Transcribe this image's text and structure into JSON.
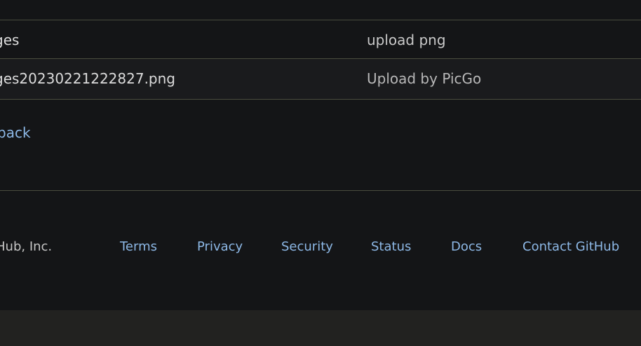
{
  "file_list": {
    "rows": [
      {
        "name": "ges",
        "commit_message": "upload png"
      },
      {
        "name": "ges20230221222827.png",
        "commit_message": "Upload by PicGo"
      }
    ]
  },
  "back_link": "back",
  "footer": {
    "copyright": "Hub, Inc.",
    "links": {
      "terms": "Terms",
      "privacy": "Privacy",
      "security": "Security",
      "status": "Status",
      "docs": "Docs",
      "contact": "Contact GitHub"
    }
  },
  "colors": {
    "background": "#141517",
    "link": "#8db8e6",
    "divider": "#4a4d3e",
    "bottom_band": "#222220"
  }
}
